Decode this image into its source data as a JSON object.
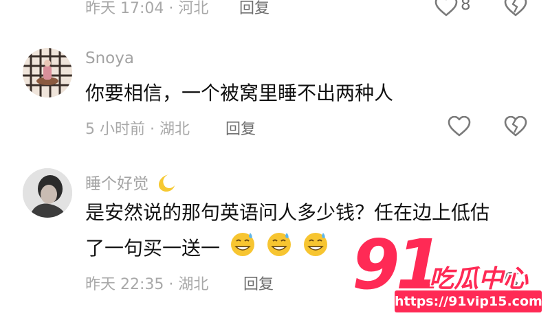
{
  "top_comment": {
    "meta": "昨天 17:04 · 河北",
    "reply_label": "回复",
    "like_count": "8"
  },
  "comments": [
    {
      "username": "Snoya",
      "text": "你要相信，一个被窝里睡不出两种人",
      "meta": "5 小时前 · 湖北",
      "reply_label": "回复"
    },
    {
      "username": "睡个好觉",
      "text_line1": "是安然说的那句英语问人多少钱？任在边上低估",
      "text_line2": "了一句买一送一",
      "meta": "昨天 22:35 · 湖北",
      "reply_label": "回复"
    }
  ],
  "watermark": {
    "number": "91",
    "title": "吃瓜中心",
    "url": "https://91vip15.com"
  },
  "colors": {
    "brand": "#ff2a55",
    "meta": "#a8a8a8",
    "text": "#111111"
  }
}
